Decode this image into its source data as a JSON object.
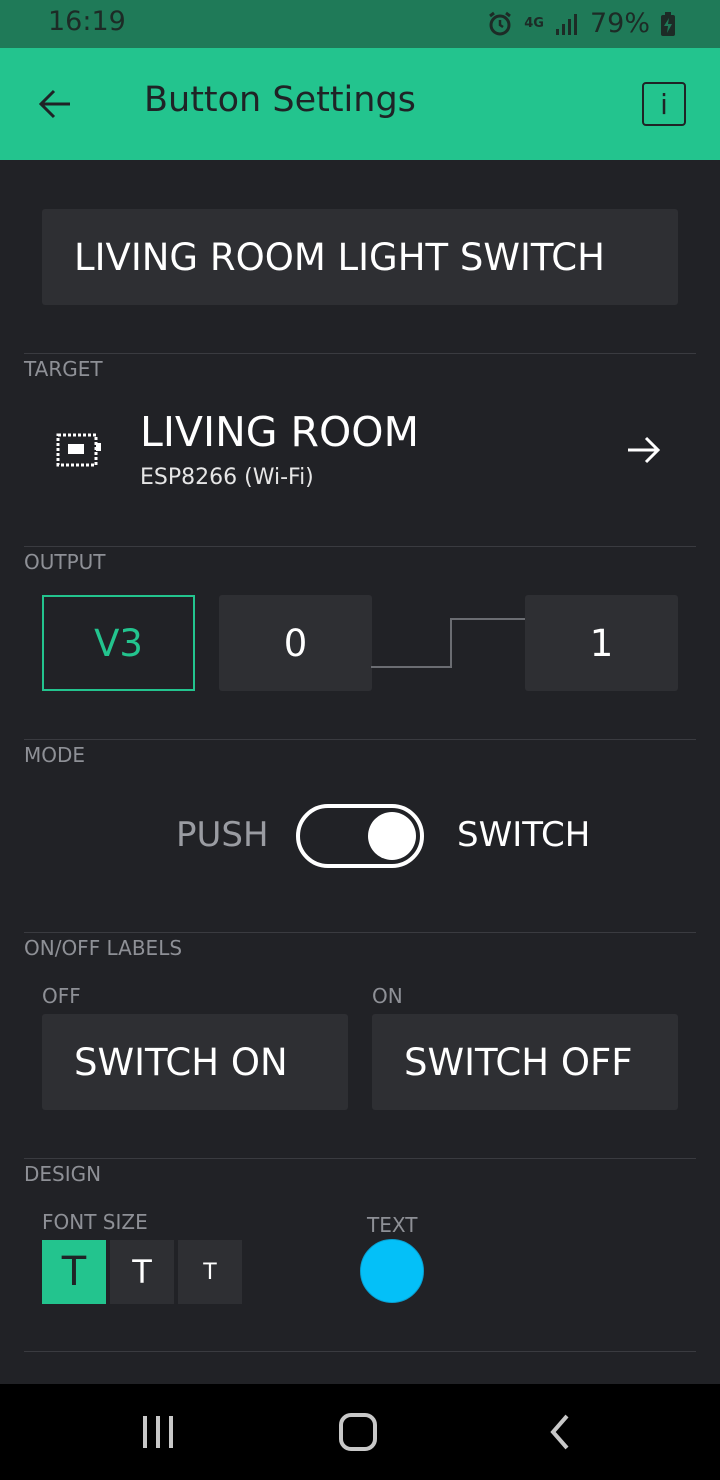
{
  "status_bar": {
    "time": "16:19",
    "network": "4G",
    "battery": "79%",
    "icons": [
      "alarm-icon",
      "network-4g-icon",
      "signal-icon",
      "battery-charging-icon"
    ]
  },
  "app_bar": {
    "title": "Button Settings",
    "info_label": "i",
    "color": "#23c48e"
  },
  "widget_name": "LIVING ROOM LIGHT SWITCH",
  "target": {
    "section_label": "TARGET",
    "device_name": "LIVING ROOM",
    "device_type": "ESP8266 (Wi-Fi)"
  },
  "output": {
    "section_label": "OUTPUT",
    "pin": "V3",
    "low_value": "0",
    "high_value": "1"
  },
  "mode": {
    "section_label": "MODE",
    "push_label": "PUSH",
    "switch_label": "SWITCH",
    "selected": "SWITCH"
  },
  "labels": {
    "section_label": "ON/OFF LABELS",
    "off_caption": "OFF",
    "on_caption": "ON",
    "off_value": "SWITCH ON",
    "on_value": "SWITCH OFF"
  },
  "design": {
    "section_label": "DESIGN",
    "font_size_caption": "FONT SIZE",
    "font_sizes": [
      "T",
      "T",
      "T"
    ],
    "selected_font_size_index": 0,
    "text_caption": "TEXT",
    "text_color": "#04c0f8"
  },
  "colors": {
    "accent": "#23c48e",
    "background": "#212226",
    "field": "#2e2f33"
  }
}
